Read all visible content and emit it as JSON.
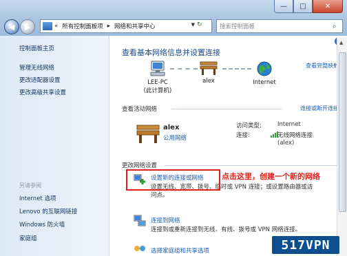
{
  "window": {
    "minimize": "—",
    "maximize": "□",
    "close": "✕"
  },
  "address": {
    "chevron": "«",
    "crumbs": [
      "所有控制面板项",
      "网络和共享中心"
    ],
    "separator": "▸"
  },
  "search": {
    "placeholder": "搜索控制面板"
  },
  "sidebar": {
    "home": "控制面板主页",
    "items": [
      "管理无线网络",
      "更改适配器设置",
      "更改高级共享设置"
    ],
    "see_also_label": "另请参阅",
    "see_also": [
      "Internet 选项",
      "Lenovo 的互联网链接",
      "Windows 防火墙",
      "家庭组"
    ]
  },
  "main": {
    "title": "查看基本网络信息并设置连接",
    "full_map": "查看完整映射",
    "map": {
      "pc_name": "LEE-PC",
      "pc_sub": "(此计算机)",
      "network": "alex",
      "internet": "Internet"
    },
    "active": {
      "section": "查看活动网络",
      "connect_link": "连接或断开连接",
      "name": "alex",
      "type": "公用网络",
      "access_label": "访问类型:",
      "access_value": "Internet",
      "conn_label": "连接:",
      "conn_value": "无线网络连接",
      "conn_sub": "(alex)"
    },
    "change": {
      "section": "更改网络设置",
      "tasks": [
        {
          "title": "设置新的连接或网络",
          "desc1": "设置无线、宽带、拨号、临时或 VPN 连接；或设置路由器或访",
          "desc2": "问点。"
        },
        {
          "title": "连接到网络",
          "desc1": "连接到或重新连接到无线、有线、拨号或 VPN 网络连接。"
        },
        {
          "title": "选择家庭组和共享选项"
        }
      ]
    },
    "annotation": "点击这里，创建一个新的网络"
  },
  "watermark": "517VPN",
  "colors": {
    "link": "#1a5dbf",
    "annotation": "#e1211a",
    "titlebar": "#a8c3e0",
    "watermark_bg": "#0d4f8e"
  },
  "icons": {
    "back": "back-arrow-icon",
    "forward": "forward-arrow-icon",
    "computer": "computer-icon",
    "bench": "bench-network-icon",
    "globe": "globe-icon",
    "signal": "wifi-signal-icon",
    "task_network": "network-setup-icon",
    "task_connect": "connect-network-icon",
    "task_homegroup": "homegroup-icon"
  }
}
